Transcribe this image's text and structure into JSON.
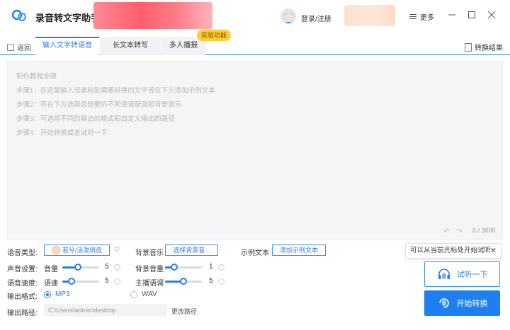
{
  "app": {
    "title": "录音转文字助手"
  },
  "header": {
    "login_label": "登录/注册",
    "more_label": "更多"
  },
  "nav": {
    "back_label": "返回",
    "tabs": [
      {
        "label": "输入文字转语音",
        "active": true
      },
      {
        "label": "长文本转写",
        "active": false
      },
      {
        "label": "多人播报",
        "active": false
      }
    ],
    "lab_badge": "实验功能",
    "result_label": "转换结果"
  },
  "editor": {
    "placeholder_lines": [
      "制作教程步骤",
      "步骤1：在这里输入或者粘贴需要转换的文字或在下方添加示例文本",
      "步骤2：可在下方选择您想要的不同语音配音和背景音乐",
      "步骤3：可选择不同的输出的格式和自定义输出的路径",
      "步骤4：开始转换或者试听一下"
    ],
    "char_count": "0 / 3000"
  },
  "settings": {
    "voice_type_label": "语音类型:",
    "voice_name": "若兮/活泼俏皮",
    "bg_music_label": "背景音乐",
    "bg_music_button": "选择背景音...",
    "example_label": "示例文本",
    "example_button": "添加示例文本",
    "sound_settings_label": "声音设置:",
    "volume_label": "音量",
    "volume_value": "5",
    "bg_volume_label": "背景音量",
    "bg_volume_value": "1",
    "speed_section_label": "语音速度:",
    "speed_label": "语速",
    "speed_value": "5",
    "pitch_label": "主播语调",
    "pitch_value": "5",
    "format_label": "输出格式:",
    "format_options": [
      {
        "label": "MP3",
        "selected": true
      },
      {
        "label": "WAV",
        "selected": false
      }
    ],
    "path_label": "输出路径:",
    "path_value": "C:\\Users\\admin\\desktop",
    "change_path_label": "更改路径"
  },
  "actions": {
    "tip_text": "可以从当前光标处开始试听",
    "listen_label": "试听一下",
    "convert_label": "开始转换"
  },
  "colors": {
    "accent": "#2b7de9",
    "badge": "#ffcc33"
  }
}
